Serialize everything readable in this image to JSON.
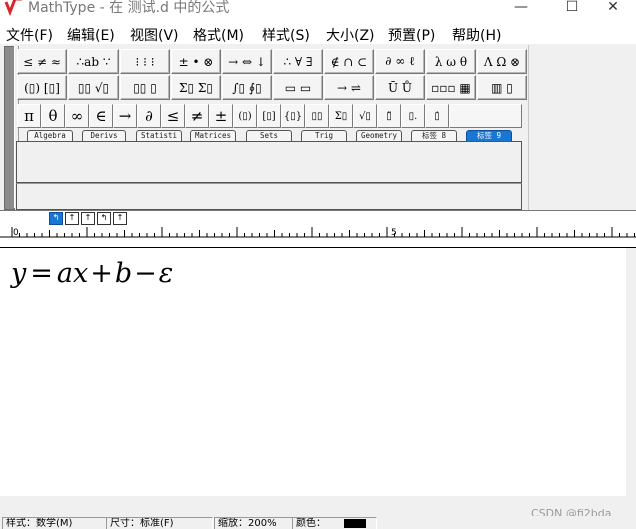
{
  "window": {
    "title": "MathType - 在 测试.d 中的公式",
    "minimize": "—",
    "maximize": "☐",
    "close": "✕"
  },
  "menu": [
    "文件(F)",
    "编辑(E)",
    "视图(V)",
    "格式(M)",
    "样式(S)",
    "大小(Z)",
    "预置(P)",
    "帮助(H)"
  ],
  "palette": {
    "row1": [
      "≤ ≠ ≈",
      "∴ab ∵",
      "⁝ ⁝ ⁝",
      "± • ⊗",
      "→ ⇔ ↓",
      "∴ ∀ ∃",
      "∉ ∩ ⊂",
      "∂ ∞ ℓ",
      "λ ω θ",
      "Λ Ω ⊗"
    ],
    "row2": [
      "(▯) [▯]",
      "▯▯ √▯",
      "▯▯ ▯",
      "Σ▯ Σ▯",
      "∫▯ ∮▯",
      "▭ ▭",
      "→ ⇌",
      "Ū Ů",
      "▫▫▫ ▦",
      "▥ ▯"
    ],
    "small": [
      "π",
      "θ",
      "∞",
      "∈",
      "→",
      "∂",
      "≤",
      "≠",
      "±",
      "(▯)",
      "[▯]",
      "{▯}",
      "▯▯",
      "Σ▯",
      "√▯",
      "▯̈",
      "▯.",
      "▯̇"
    ],
    "tabs": [
      "Algebra",
      "Derivs",
      "Statisti",
      "Matrices",
      "Sets",
      "Trig",
      "Geometry",
      "标签 8",
      "标签 9"
    ]
  },
  "ruler": {
    "tabstops": [
      "↰",
      "↑",
      "↑",
      "↰",
      "↑"
    ],
    "labels": [
      "0",
      "5"
    ]
  },
  "equation": {
    "y": "y",
    "eq": "=",
    "a": "a",
    "x": "x",
    "plus": "+",
    "b": "b",
    "minus": "−",
    "eps": "ε"
  },
  "watermark": "CSDN @fi2bda",
  "status": {
    "style": "样式：数学(M)",
    "size": "尺寸：标准(F)",
    "zoom": "缩放：200%",
    "color": "颜色："
  },
  "colors": {
    "active_tab": "#1976d2",
    "logo": "#d9252b"
  }
}
